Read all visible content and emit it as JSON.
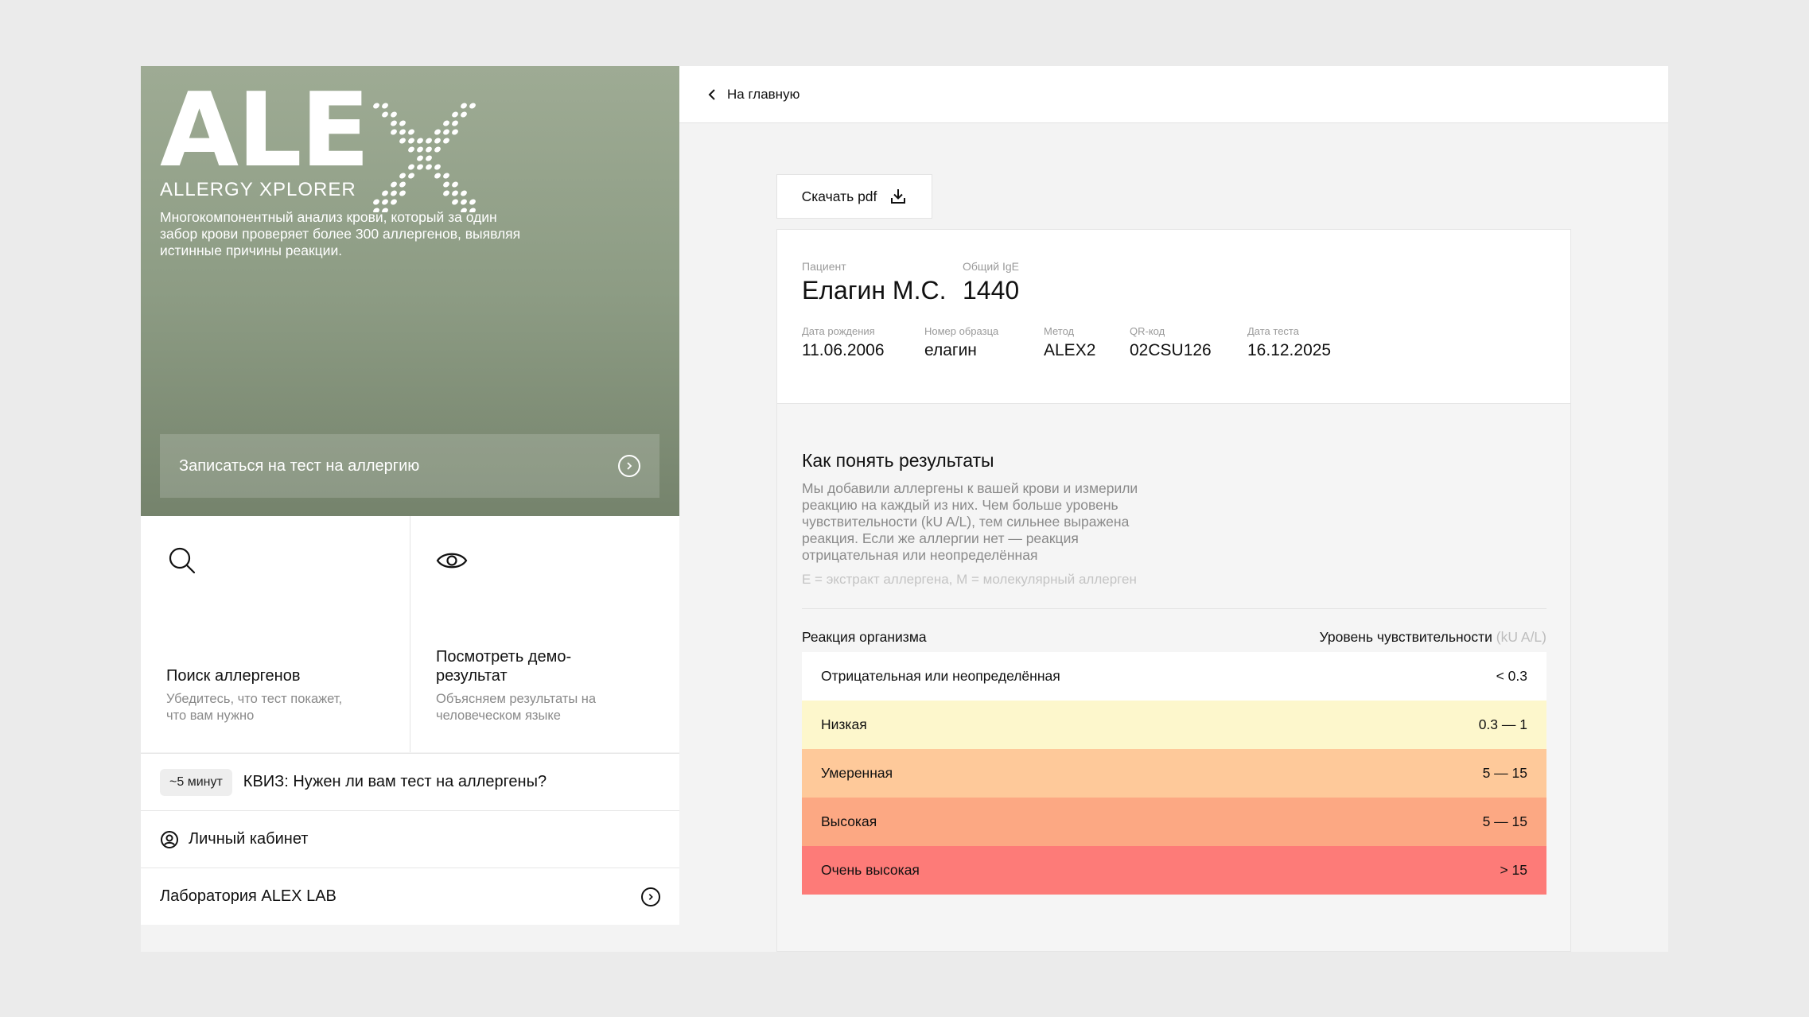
{
  "sidebar": {
    "logo_word": "ALE",
    "logo_letter": "X",
    "logo_subtitle": "ALLERGY XPLORER",
    "description": "Многокомпонентный анализ крови, который за один забор крови проверяет более 300 аллергенов, выявляя истинные причины реакции.",
    "cta_label": "Записаться на тест на аллергию",
    "cards": [
      {
        "icon": "search-icon",
        "title": "Поиск аллергенов",
        "subtitle": "Убедитесь, что тест покажет, что вам нужно"
      },
      {
        "icon": "eye-icon",
        "title": "Посмотреть демо-результат",
        "subtitle": "Объясняем результаты на человеческом языке"
      }
    ],
    "quiz_badge": "~5 минут",
    "quiz_label": "КВИЗ: Нужен ли вам тест на аллергены?",
    "account_label": "Личный кабинет",
    "lab_label": "Лаборатория ALEX LAB"
  },
  "topbar": {
    "back_label": "На главную"
  },
  "pdf_button": {
    "label": "Скачать pdf"
  },
  "patient": {
    "name_label": "Пациент",
    "name": "Елагин М.С.",
    "ige_label": "Общий IgE",
    "ige": "1440",
    "fields": [
      {
        "label": "Дата рождения",
        "value": "11.06.2006"
      },
      {
        "label": "Номер образца",
        "value": "елагин"
      },
      {
        "label": "Метод",
        "value": "ALEX2"
      },
      {
        "label": "QR-код",
        "value": "02CSU126"
      },
      {
        "label": "Дата теста",
        "value": "16.12.2025"
      }
    ]
  },
  "legend": {
    "title": "Как понять результаты",
    "description": "Мы добавили аллергены к вашей крови и измерили реакцию на каждый из них. Чем больше уровень чувствительности (kU A/L), тем сильнее выражена реакция. Если же аллергии нет — реакция отрицательная или неопределённая",
    "note": "E = экстракт аллергена, M = молекулярный аллерген",
    "col_reaction": "Реакция организма",
    "col_level": "Уровень чувствительности",
    "col_unit": "(kU A/L)",
    "rows": [
      {
        "label": "Отрицательная или неопределённая",
        "range": "< 0.3",
        "color": "#ffffff"
      },
      {
        "label": "Низкая",
        "range": "0.3 — 1",
        "color": "#fdf7cc"
      },
      {
        "label": "Умеренная",
        "range": "5 — 15",
        "color": "#fec99a"
      },
      {
        "label": "Высокая",
        "range": "5 — 15",
        "color": "#fca883"
      },
      {
        "label": "Очень высокая",
        "range": "> 15",
        "color": "#fd7b78"
      }
    ]
  },
  "colors": {
    "hero_top": "#9eab94",
    "hero_bottom": "#75836c"
  }
}
